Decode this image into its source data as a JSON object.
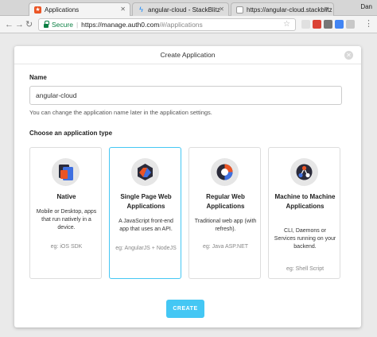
{
  "browser": {
    "tabs": [
      {
        "label": "Applications",
        "icon": "auth0-shield-icon",
        "color": "#eb5424",
        "active": true
      },
      {
        "label": "angular-cloud - StackBlitz",
        "icon": "stackblitz-bolt-icon",
        "color": "#1389fd",
        "active": false
      },
      {
        "label": "https://angular-cloud.stackblitz",
        "icon": "page-icon",
        "color": "#999999",
        "active": false
      }
    ],
    "profile": "Dan",
    "address": {
      "secure_label": "Secure",
      "host": "https://manage.auth0.com",
      "path": "/#/applications"
    }
  },
  "modal": {
    "title": "Create Application",
    "name_label": "Name",
    "name_value": "angular-cloud",
    "name_help": "You can change the application name later in the application settings.",
    "type_label": "Choose an application type",
    "create_label": "CREATE",
    "accent": "#44c7f4",
    "cards": [
      {
        "title": "Native",
        "desc": "Mobile or Desktop, apps that run natively in a device.",
        "eg": "eg: iOS SDK",
        "icon": "native-app-icon",
        "selected": false
      },
      {
        "title": "Single Page Web Applications",
        "desc": "A JavaScript front-end app that uses an API.",
        "eg": "eg: AngularJS + NodeJS",
        "icon": "spa-icon",
        "selected": true
      },
      {
        "title": "Regular Web Applications",
        "desc": "Traditional web app (with refresh).",
        "eg": "eg: Java ASP.NET",
        "icon": "regular-web-app-icon",
        "selected": false
      },
      {
        "title": "Machine to Machine Applications",
        "desc": "CLI, Daemons or Services running on your backend.",
        "eg": "eg: Shell Script",
        "icon": "machine-to-machine-icon",
        "selected": false
      }
    ]
  }
}
